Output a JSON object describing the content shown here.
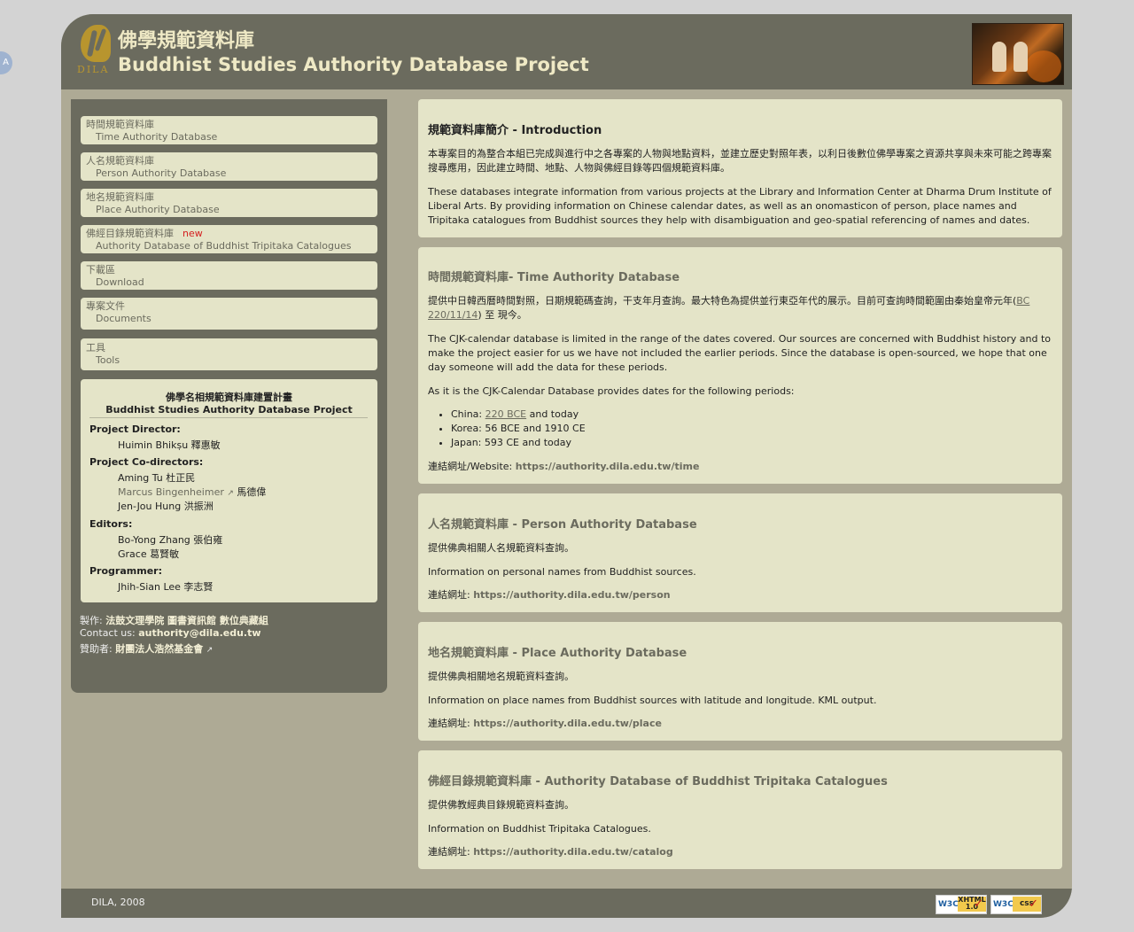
{
  "side_tab": "A",
  "header": {
    "logo_text": "DILA",
    "title_zh": "佛學規範資料庫",
    "title_en": "Buddhist Studies Authority Database Project"
  },
  "nav": [
    {
      "zh": "時間規範資料庫",
      "en": "Time Authority Database"
    },
    {
      "zh": "人名規範資料庫",
      "en": "Person Authority Database"
    },
    {
      "zh": "地名規範資料庫",
      "en": "Place Authority Database"
    },
    {
      "zh": "佛經目錄規範資料庫",
      "en": "Authority Database of Buddhist Tripitaka Catalogues",
      "badge": "new"
    },
    {
      "zh": "下載區",
      "en": "Download"
    },
    {
      "zh": "專案文件",
      "en": "Documents"
    },
    {
      "zh": "工具",
      "en": "Tools"
    }
  ],
  "credits": {
    "title_zh": "佛學名相規範資料庫建置計畫",
    "title_en": "Buddhist Studies Authority Database Project",
    "director_label": "Project Director:",
    "director": "Huimin Bhikṣu 釋惠敏",
    "codirectors_label": "Project Co-directors:",
    "codirector_1": "Aming Tu 杜正民",
    "codirector_2_link": "Marcus Bingenheimer",
    "codirector_2_zh": "馬德偉",
    "codirector_3": "Jen-Jou Hung 洪振洲",
    "editors_label": "Editors:",
    "editor_1": "Bo-Yong Zhang 張伯雍",
    "editor_2": "Grace 葛賢敏",
    "programmer_label": "Programmer:",
    "programmer": "Jhih-Sian Lee 李志賢"
  },
  "sidebar_footer": {
    "made_label": "製作:",
    "made_value": "法鼓文理學院 圖書資訊館 數位典藏組",
    "contact_label": "Contact us:",
    "contact_value": "authority@dila.edu.tw",
    "sponsor_label": "贊助者:",
    "sponsor_value": "財團法人浩然基金會"
  },
  "intro": {
    "title": "規範資料庫簡介 - Introduction",
    "p_zh": "本專案目的為整合本組已完成與進行中之各專案的人物與地點資料，並建立歷史對照年表，以利日後數位佛學專案之資源共享與未來可能之跨專案搜尋應用，因此建立時間、地點、人物與佛經目錄等四個規範資料庫。",
    "p_en": "These databases integrate information from various projects at the Library and Information Center at Dharma Drum Institute of Liberal Arts. By providing information on Chinese calendar dates, as well as an onomasticon of person, place names and Tripitaka catalogues from Buddhist sources they help with disambiguation and geo-spatial referencing of names and dates."
  },
  "time": {
    "title": "時間規範資料庫- Time Authority Database",
    "p_zh_1": "提供中日韓西曆時間對照，日期規範碼查詢，干支年月查詢。最大特色為提供並行東亞年代的展示。目前可查詢時間範圍由秦始皇帝元年(",
    "p_zh_link": "BC 220/11/14",
    "p_zh_2": ") 至 現今。",
    "p_en": "The CJK-calendar database is limited in the range of the dates covered. Our sources are concerned with Buddhist history and to make the project easier for us we have not included the earlier periods. Since the database is open-sourced, we hope that one day someone will add the data for these periods.",
    "p_en_2": "As it is the CJK-Calendar Database provides dates for the following periods:",
    "li_1_a": "China: ",
    "li_1_link": "220 BCE",
    "li_1_b": " and today",
    "li_2": "Korea: 56 BCE and 1910 CE",
    "li_3": "Japan: 593 CE and today",
    "url_label": "連結網址/Website: ",
    "url": "https://authority.dila.edu.tw/time"
  },
  "person": {
    "title": "人名規範資料庫 - Person Authority Database",
    "p_zh": "提供佛典相關人名規範資料查詢。",
    "p_en": "Information on personal names from Buddhist sources.",
    "url_label": "連結網址: ",
    "url": "https://authority.dila.edu.tw/person"
  },
  "place": {
    "title": "地名規範資料庫 - Place Authority Database",
    "p_zh": "提供佛典相關地名規範資料查詢。",
    "p_en": "Information on place names from Buddhist sources with latitude and longitude. KML output.",
    "url_label": "連結網址: ",
    "url": "https://authority.dila.edu.tw/place"
  },
  "catalog": {
    "title": "佛經目錄規範資料庫 - Authority Database of Buddhist Tripitaka Catalogues",
    "p_zh": "提供佛教經典目錄規範資料查詢。",
    "p_en": "Information on Buddhist Tripitaka Catalogues.",
    "url_label": "連結網址: ",
    "url": "https://authority.dila.edu.tw/catalog"
  },
  "footer": {
    "copyright": "DILA, 2008",
    "badge_1_a": "W3C",
    "badge_1_b": "XHTML 1.0",
    "badge_2_a": "W3C",
    "badge_2_b": "css"
  }
}
